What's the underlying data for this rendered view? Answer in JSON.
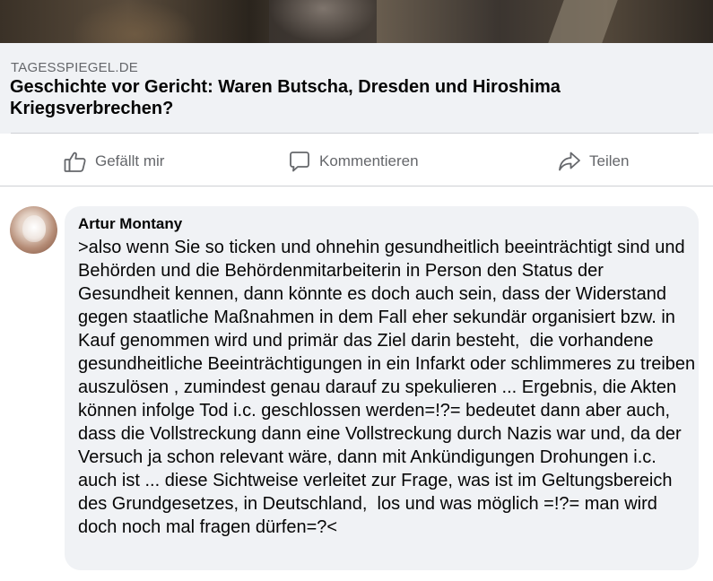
{
  "link_preview": {
    "domain": "TAGESSPIEGEL.DE",
    "title": "Geschichte vor Gericht: Waren Butscha, Dresden und Hiroshima Kriegsverbrechen?"
  },
  "actions": {
    "like_label": "Gefällt mir",
    "comment_label": "Kommentieren",
    "share_label": "Teilen"
  },
  "comment": {
    "author": "Artur Montany",
    "text": ">also wenn Sie so ticken und ohnehin gesundheitlich beeinträchtigt sind und Behörden und die Behördenmitarbeiterin in Person den Status der Gesundheit kennen, dann könnte es doch auch sein, dass der Widerstand gegen staatliche Maßnahmen in dem Fall eher sekundär organisiert bzw. in Kauf genommen wird und primär das Ziel darin besteht,  die vorhandene gesundheitliche Beeinträchtigungen in ein Infarkt oder schlimmeres zu treiben auszulösen , zumindest genau darauf zu spekulieren ... Ergebnis, die Akten können infolge Tod i.c. geschlossen werden=!?= bedeutet dann aber auch, dass die Vollstreckung dann eine Vollstreckung durch Nazis war und, da der Versuch ja schon relevant wäre, dann mit Ankündigungen Drohungen i.c. auch ist ... diese Sichtweise verleitet zur Frage, was ist im Geltungsbereich des Grundgesetzes, in Deutschland,  los und was möglich =!?= man wird doch noch mal fragen dürfen=?<"
  },
  "icons": {
    "like": "thumbs-up-icon",
    "comment": "speech-bubble-icon",
    "share": "share-arrow-icon"
  },
  "colors": {
    "card_bg": "#f0f2f5",
    "secondary_text": "#65676b",
    "primary_text": "#050505",
    "divider": "#ced0d4"
  }
}
